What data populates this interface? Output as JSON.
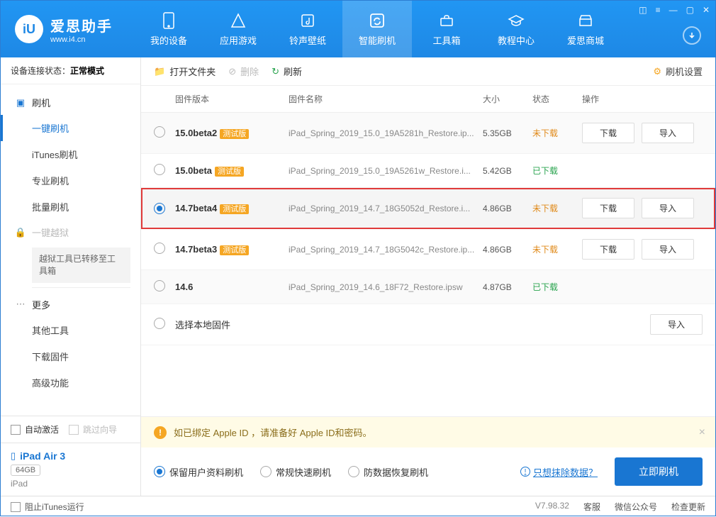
{
  "app": {
    "name": "爱思助手",
    "url": "www.i4.cn"
  },
  "nav": [
    {
      "label": "我的设备"
    },
    {
      "label": "应用游戏"
    },
    {
      "label": "铃声壁纸"
    },
    {
      "label": "智能刷机"
    },
    {
      "label": "工具箱"
    },
    {
      "label": "教程中心"
    },
    {
      "label": "爱思商城"
    }
  ],
  "conn": {
    "prefix": "设备连接状态：",
    "mode": "正常模式"
  },
  "side": {
    "flash_head": "刷机",
    "items": [
      "一键刷机",
      "iTunes刷机",
      "专业刷机",
      "批量刷机"
    ],
    "jailbreak": "一键越狱",
    "jb_note": "越狱工具已转移至工具箱",
    "more_head": "更多",
    "more_items": [
      "其他工具",
      "下载固件",
      "高级功能"
    ]
  },
  "sb_bottom": {
    "auto_activate": "自动激活",
    "skip_guide": "跳过向导",
    "device_name": "iPad Air 3",
    "capacity": "64GB",
    "device_type": "iPad",
    "block_itunes": "阻止iTunes运行"
  },
  "toolbar": {
    "open": "打开文件夹",
    "delete": "删除",
    "refresh": "刷新",
    "settings": "刷机设置"
  },
  "thead": {
    "ver": "固件版本",
    "name": "固件名称",
    "size": "大小",
    "status": "状态",
    "ops": "操作"
  },
  "badge": "测试版",
  "btn": {
    "download": "下载",
    "import": "导入"
  },
  "status": {
    "not": "未下载",
    "done": "已下载"
  },
  "rows": [
    {
      "ver": "15.0beta2",
      "beta": true,
      "name": "iPad_Spring_2019_15.0_19A5281h_Restore.ip...",
      "size": "5.35GB",
      "status": "not",
      "ops": true,
      "selected": false
    },
    {
      "ver": "15.0beta",
      "beta": true,
      "name": "iPad_Spring_2019_15.0_19A5261w_Restore.i...",
      "size": "5.42GB",
      "status": "done",
      "ops": false,
      "selected": false
    },
    {
      "ver": "14.7beta4",
      "beta": true,
      "name": "iPad_Spring_2019_14.7_18G5052d_Restore.i...",
      "size": "4.86GB",
      "status": "not",
      "ops": true,
      "selected": true,
      "hl": true
    },
    {
      "ver": "14.7beta3",
      "beta": true,
      "name": "iPad_Spring_2019_14.7_18G5042c_Restore.ip...",
      "size": "4.86GB",
      "status": "not",
      "ops": true,
      "selected": false
    },
    {
      "ver": "14.6",
      "beta": false,
      "name": "iPad_Spring_2019_14.6_18F72_Restore.ipsw",
      "size": "4.87GB",
      "status": "done",
      "ops": false,
      "selected": false
    }
  ],
  "local_fw": "选择本地固件",
  "warning": "如已绑定 Apple ID ，请准备好 Apple ID和密码。",
  "modes": {
    "keep": "保留用户资料刷机",
    "normal": "常规快速刷机",
    "recover": "防数据恢复刷机"
  },
  "erase_link": "只想抹除数据？",
  "flash_now": "立即刷机",
  "status_bar": {
    "version": "V7.98.32",
    "service": "客服",
    "wechat": "微信公众号",
    "check_update": "检查更新"
  }
}
